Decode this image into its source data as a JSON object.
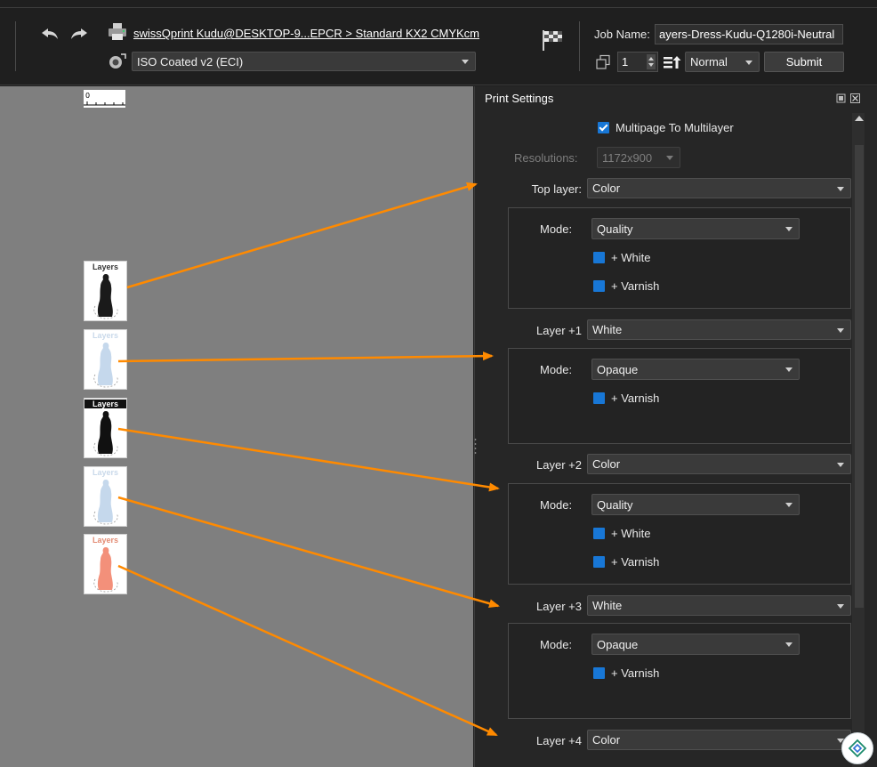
{
  "toolbar": {
    "printer_link": "swissQprint Kudu@DESKTOP-9...EPCR > Standard KX2 CMYKcm",
    "profile": "ISO Coated v2 (ECI)",
    "job_name_label": "Job Name:",
    "job_name_value": "ayers-Dress-Kudu-Q1280i-Neutral",
    "copies": "1",
    "priority": "Normal",
    "submit_label": "Submit"
  },
  "canvas": {
    "thumbnails": [
      {
        "label": "Layers",
        "label_color": "#333333",
        "figure": "#1a1a1a",
        "bg": "#ffffff"
      },
      {
        "label": "Layers",
        "label_color": "#c9d9ea",
        "figure": "#c5d8ec",
        "bg": "#ffffff"
      },
      {
        "label": "Layers",
        "label_color": "#ffffff",
        "figure": "#111111",
        "bg": "#ffffff"
      },
      {
        "label": "Layers",
        "label_color": "#c9d9ea",
        "figure": "#c5d8ec",
        "bg": "#ffffff"
      },
      {
        "label": "Layers",
        "label_color": "#e38b73",
        "figure": "#f3907a",
        "bg": "#ffffff"
      }
    ],
    "arrow_color": "#ff8a00"
  },
  "panel": {
    "title": "Print Settings",
    "multipage_label": "Multipage To Multilayer",
    "resolutions_label": "Resolutions:",
    "resolutions_value": "1172x900",
    "mode_label": "Mode:",
    "white_label": "+ White",
    "varnish_label": "+ Varnish",
    "layers": [
      {
        "label": "Top layer:",
        "value": "Color",
        "mode": "Quality"
      },
      {
        "label": "Layer +1",
        "value": "White",
        "mode": "Opaque"
      },
      {
        "label": "Layer +2",
        "value": "Color",
        "mode": "Quality"
      },
      {
        "label": "Layer +3",
        "value": "White",
        "mode": "Opaque"
      },
      {
        "label": "Layer +4",
        "value": "Color"
      }
    ]
  },
  "colors": {
    "accent_checkbox": "#1877d6",
    "panel_bg": "#262626",
    "canvas_bg": "#7f7f7f"
  }
}
